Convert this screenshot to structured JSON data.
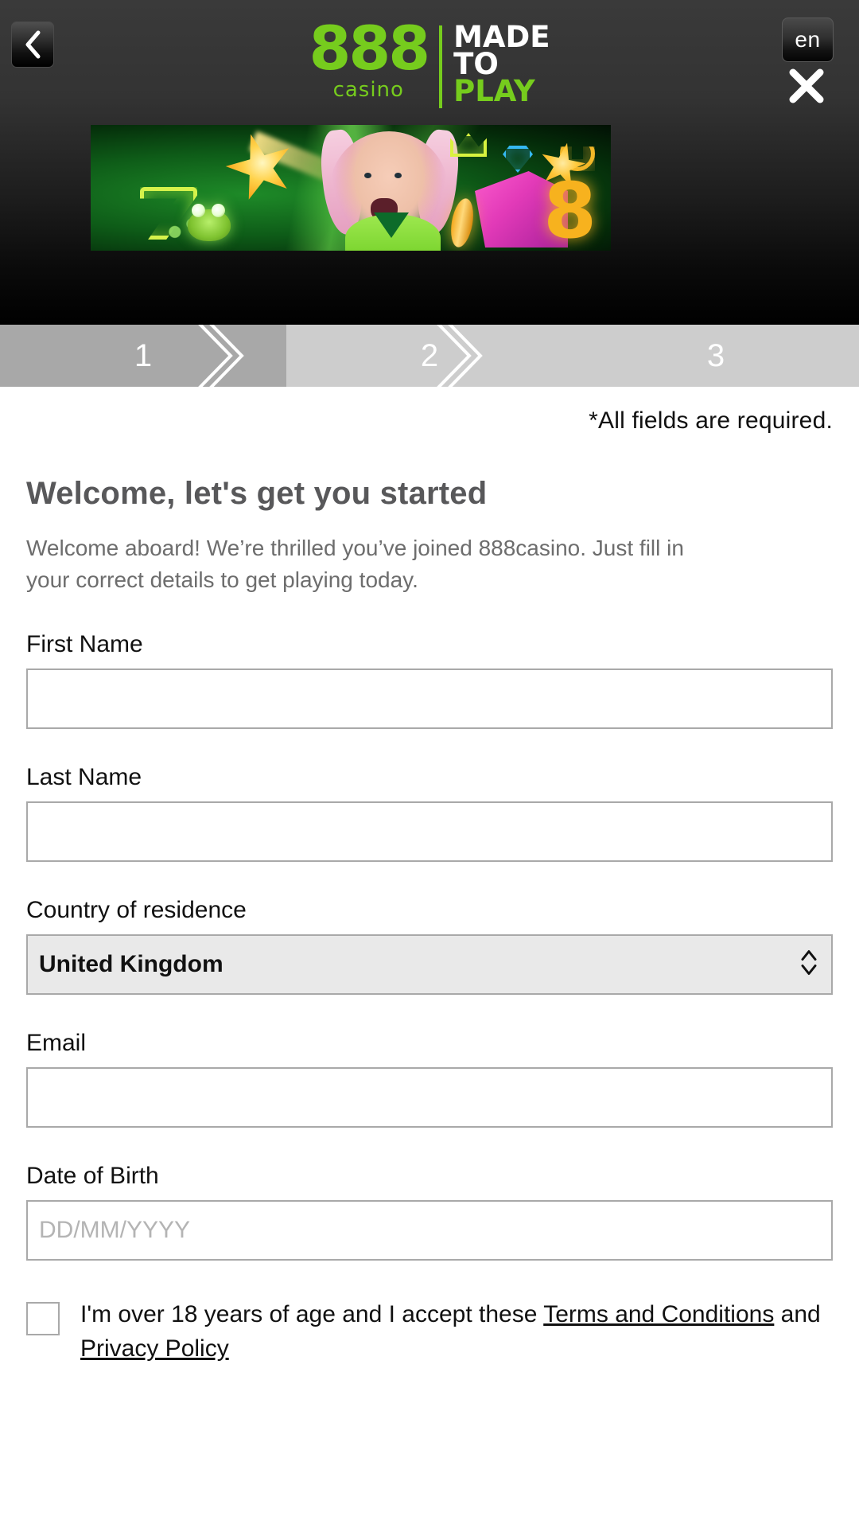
{
  "header": {
    "back_label": "Back",
    "language": "en",
    "close_label": "Close",
    "logo": {
      "brand": "888",
      "sub": "casino",
      "tag_line1": "MADE",
      "tag_line2": "TO",
      "tag_line3": "PLAY",
      "brand_color": "#76cc1d"
    },
    "banner": {
      "alt": "888casino promotional banner",
      "eight": "8"
    }
  },
  "stepper": {
    "steps": [
      {
        "number": "1",
        "state": "active"
      },
      {
        "number": "2",
        "state": "inactive"
      },
      {
        "number": "3",
        "state": "inactive"
      }
    ]
  },
  "main": {
    "required_note": "*All fields are required.",
    "title": "Welcome, let's get you started",
    "subtitle": "Welcome aboard! We’re thrilled you’ve joined 888casino. Just fill in your correct details to get playing today.",
    "fields": {
      "first_name": {
        "label": "First Name",
        "value": "",
        "placeholder": ""
      },
      "last_name": {
        "label": "Last Name",
        "value": "",
        "placeholder": ""
      },
      "country": {
        "label": "Country of residence",
        "value": "United Kingdom",
        "options": [
          "United Kingdom"
        ]
      },
      "email": {
        "label": "Email",
        "value": "",
        "placeholder": ""
      },
      "dob": {
        "label": "Date of Birth",
        "value": "",
        "placeholder": "DD/MM/YYYY"
      }
    },
    "terms": {
      "checked": false,
      "text_before": "I'm over 18 years of age and I accept these ",
      "link_terms": "Terms and Conditions",
      "text_middle": " and ",
      "link_privacy": "Privacy Policy"
    }
  },
  "colors": {
    "brand_green": "#76cc1d",
    "header_dark": "#2f2f2f",
    "step_active": "#a8a8a8",
    "step_inactive": "#cdcdcd",
    "border_gray": "#a9a9a9",
    "select_bg": "#e9e9e9"
  }
}
